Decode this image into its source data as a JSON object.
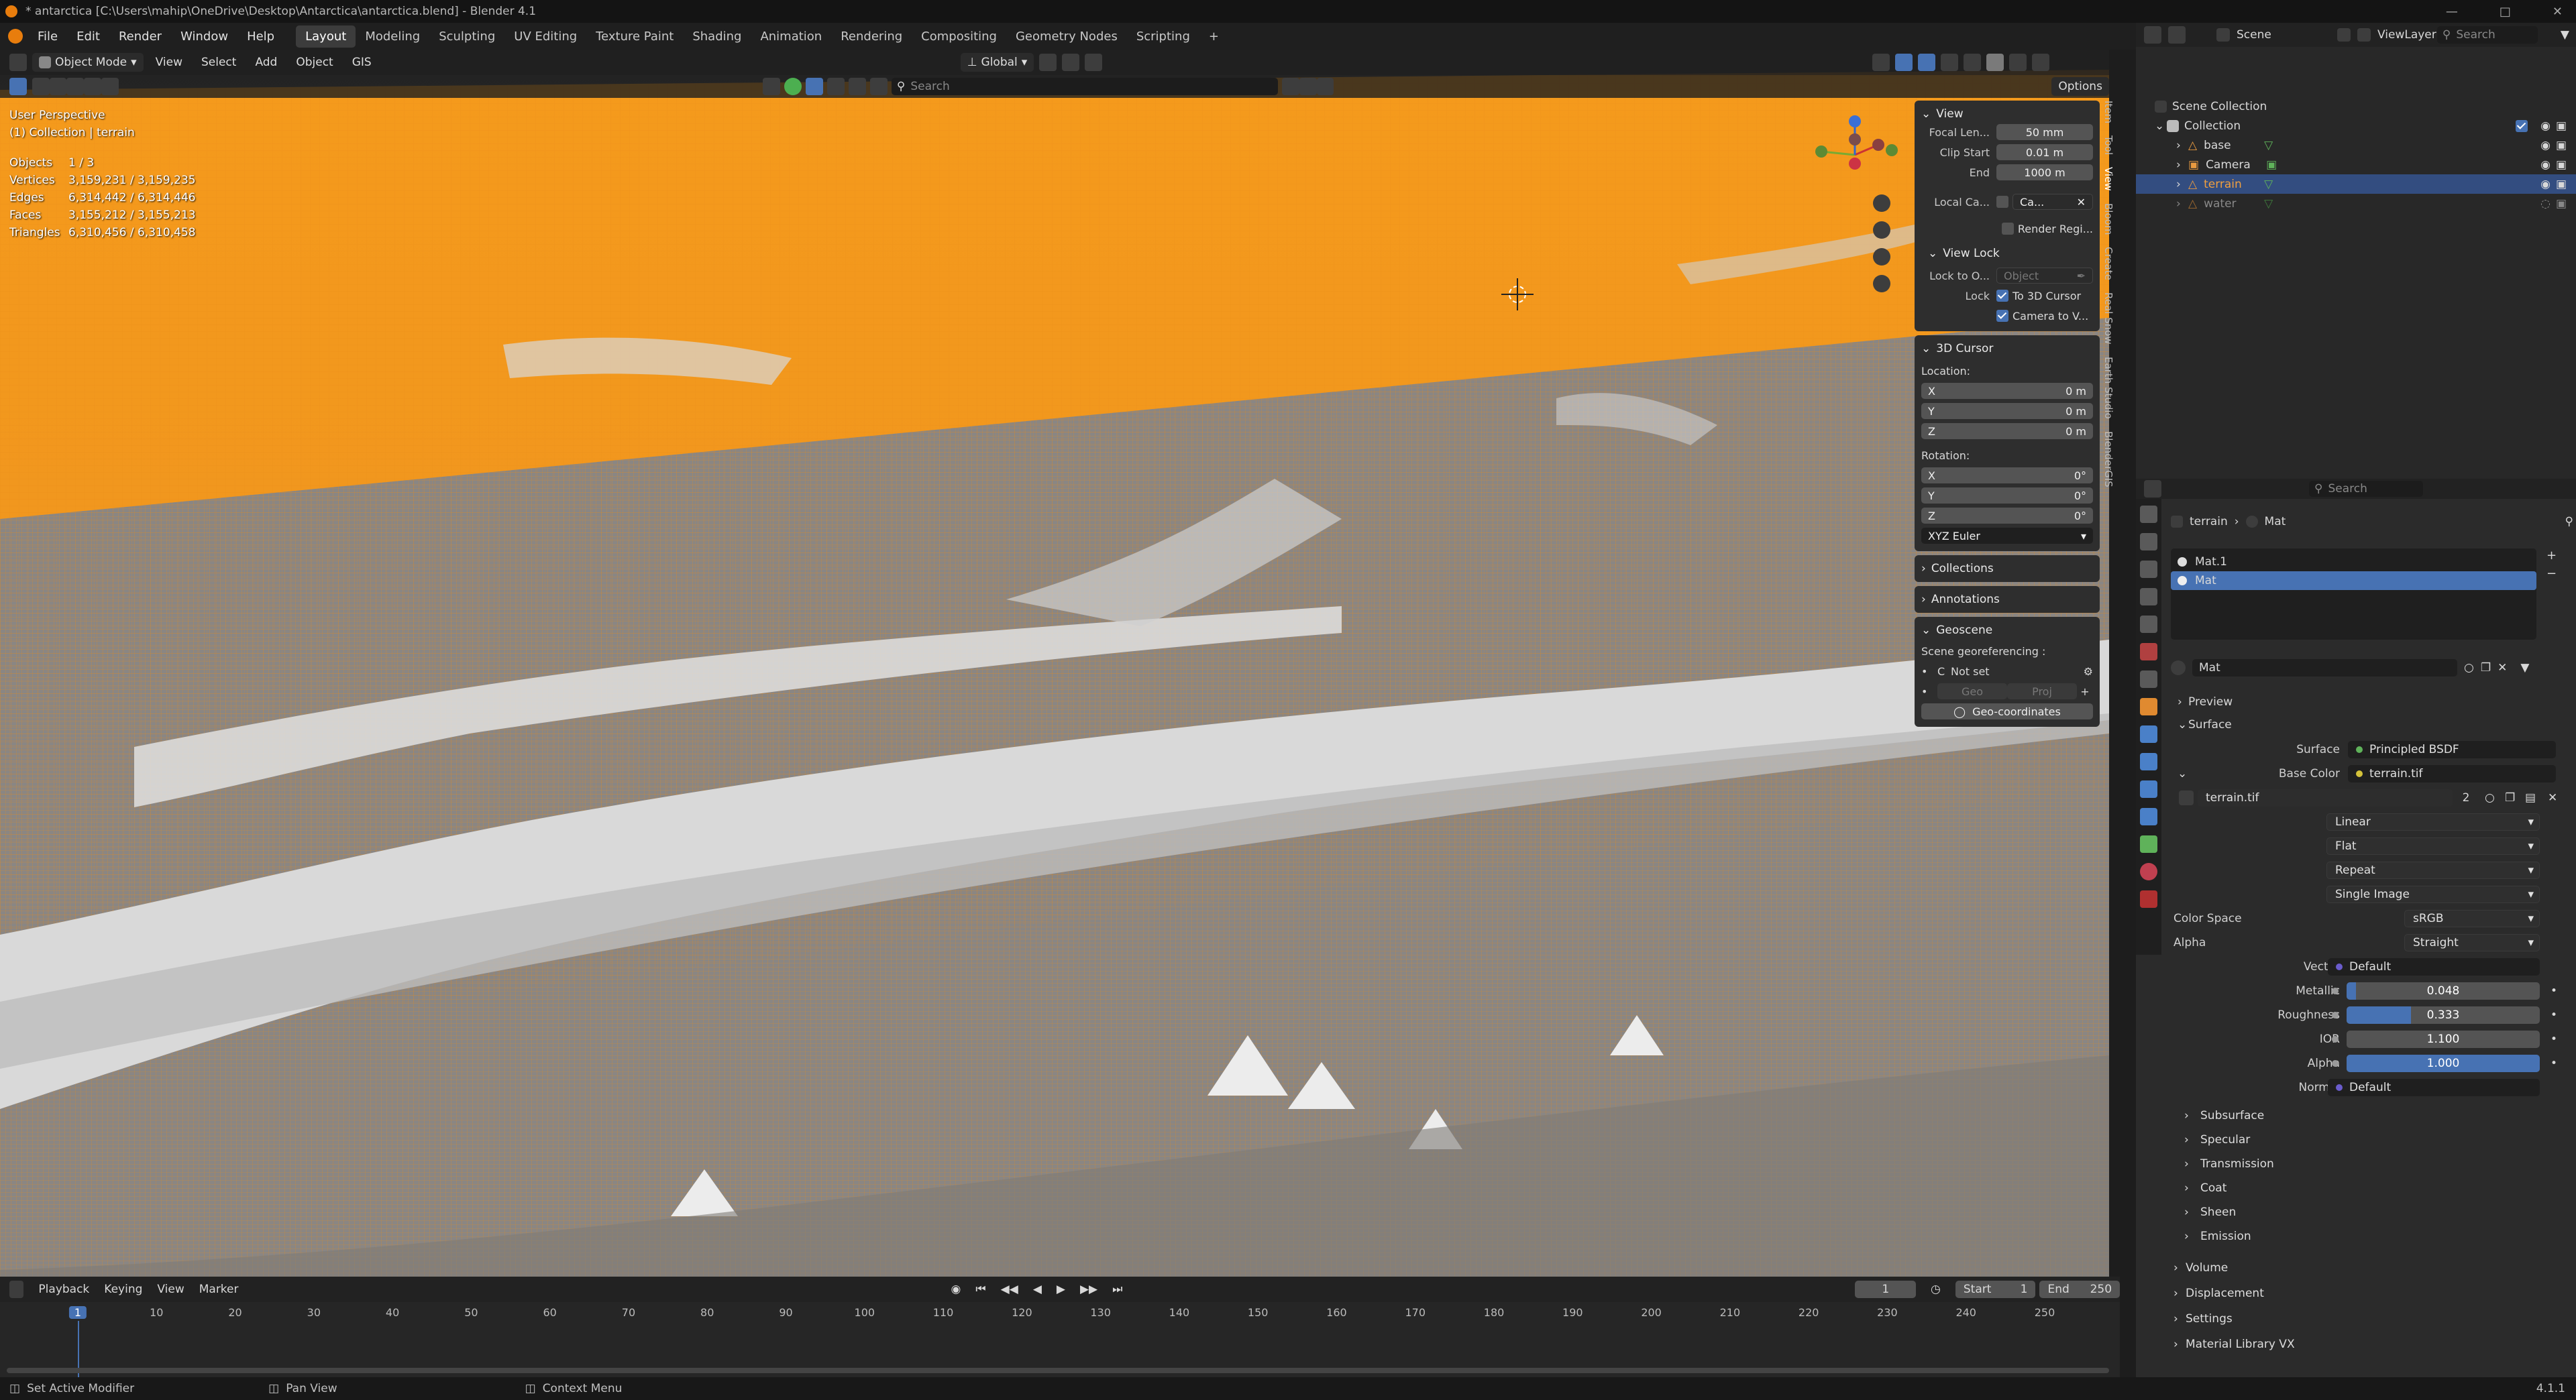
{
  "window": {
    "title": "* antarctica [C:\\Users\\mahip\\OneDrive\\Desktop\\Antarctica\\antarctica.blend] - Blender 4.1"
  },
  "menus": [
    "File",
    "Edit",
    "Render",
    "Window",
    "Help"
  ],
  "workspaces": [
    "Layout",
    "Modeling",
    "Sculpting",
    "UV Editing",
    "Texture Paint",
    "Shading",
    "Animation",
    "Rendering",
    "Compositing",
    "Geometry Nodes",
    "Scripting"
  ],
  "workspace_active": "Layout",
  "viewport": {
    "mode": "Object Mode",
    "menus": [
      "View",
      "Select",
      "Add",
      "Object",
      "GIS"
    ],
    "orientation": "Global",
    "search_placeholder": "Search",
    "options_label": "Options",
    "perspective": "User Perspective",
    "collection_line": "(1) Collection | terrain",
    "stats": [
      {
        "k": "Objects",
        "v": "1 / 3"
      },
      {
        "k": "Vertices",
        "v": "3,159,231 / 3,159,235"
      },
      {
        "k": "Edges",
        "v": "6,314,442 / 6,314,446"
      },
      {
        "k": "Faces",
        "v": "3,155,212 / 3,155,213"
      },
      {
        "k": "Triangles",
        "v": "6,310,456 / 6,310,458"
      }
    ]
  },
  "npanel": {
    "view_title": "View",
    "focal_label": "Focal Len...",
    "focal": "50 mm",
    "clip_start_label": "Clip Start",
    "clip_start": "0.01 m",
    "end_label": "End",
    "clip_end": "1000 m",
    "local_cam_label": "Local Ca...",
    "local_cam": "Ca...",
    "render_region": "Render Regi...",
    "viewlock_title": "View Lock",
    "lock_obj_label": "Lock to O...",
    "lock_obj_ph": "Object",
    "lock_label": "Lock",
    "to_cursor": "To 3D Cursor",
    "cam_to_view": "Camera to V...",
    "cursor_title": "3D Cursor",
    "location_label": "Location:",
    "rotation_label": "Rotation:",
    "x": "X",
    "y": "Y",
    "z": "Z",
    "loc_x": "0 m",
    "loc_y": "0 m",
    "loc_z": "0 m",
    "rot_x": "0°",
    "rot_y": "0°",
    "rot_z": "0°",
    "rot_mode": "XYZ Euler",
    "collections": "Collections",
    "annotations": "Annotations",
    "geoscene": "Geoscene",
    "georef_label": "Scene georeferencing :",
    "georef_status": "Not set",
    "geo_btn": "Geo",
    "proj_btn": "Proj",
    "geocoords_btn": "Geo-coordinates"
  },
  "sidetabs": [
    "Item",
    "Tool",
    "View",
    "Bloom",
    "Create",
    "Real Snow",
    "Earth Studio",
    "BlenderGIS"
  ],
  "outliner": {
    "scene_label": "Scene",
    "viewlayer_label": "ViewLayer",
    "search_placeholder": "Search",
    "root": "Scene Collection",
    "collection": "Collection",
    "items": [
      {
        "name": "base",
        "selected": false
      },
      {
        "name": "Camera",
        "selected": false
      },
      {
        "name": "terrain",
        "selected": true
      },
      {
        "name": "water",
        "selected": false
      }
    ]
  },
  "properties": {
    "search_placeholder": "Search",
    "breadcrumb_obj": "terrain",
    "breadcrumb_mat": "Mat",
    "slots": [
      "Mat.1",
      "Mat"
    ],
    "material_name": "Mat",
    "preview": "Preview",
    "surface_panel": "Surface",
    "surface_label": "Surface",
    "surface_value": "Principled BSDF",
    "basecolor_label": "Base Color",
    "basecolor_value": "terrain.tif",
    "image_name": "terrain.tif",
    "image_users": "2",
    "interp": "Linear",
    "projection": "Flat",
    "extension": "Repeat",
    "source": "Single Image",
    "colorspace_label": "Color Space",
    "colorspace": "sRGB",
    "alpha_mode_label": "Alpha",
    "alpha_mode": "Straight",
    "vector_label": "Vector",
    "vector": "Default",
    "metallic_label": "Metallic",
    "metallic": "0.048",
    "roughness_label": "Roughness",
    "roughness": "0.333",
    "ior_label": "IOR",
    "ior": "1.100",
    "alpha_label": "Alpha",
    "alpha": "1.000",
    "normal_label": "Normal",
    "normal": "Default",
    "subpanels": [
      "Subsurface",
      "Specular",
      "Transmission",
      "Coat",
      "Sheen",
      "Emission"
    ],
    "panels": [
      "Volume",
      "Displacement",
      "Settings",
      "Material Library VX"
    ]
  },
  "sliders": {
    "metallic": 0.048,
    "roughness": 0.333,
    "ior": 0.0,
    "alpha": 1.0
  },
  "timeline": {
    "menus": [
      "Playback",
      "Keying",
      "View",
      "Marker"
    ],
    "current_frame": "1",
    "start_label": "Start",
    "start": "1",
    "end_label": "End",
    "end": "250",
    "ticks": [
      "1",
      "10",
      "20",
      "30",
      "40",
      "50",
      "60",
      "70",
      "80",
      "90",
      "100",
      "110",
      "120",
      "130",
      "140",
      "150",
      "160",
      "170",
      "180",
      "190",
      "200",
      "210",
      "220",
      "230",
      "240",
      "250"
    ]
  },
  "status": {
    "left": "Set Active Modifier",
    "mid": "Pan View",
    "right": "Context Menu",
    "version": "4.1.1"
  },
  "colors": {
    "accent": "#4772b3",
    "terrain_orange": "#f0961e",
    "snow": "#e8e8e8"
  }
}
